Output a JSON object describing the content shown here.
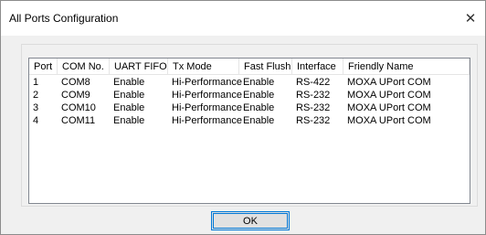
{
  "dialog": {
    "title": "All Ports Configuration",
    "close_glyph": "✕",
    "close_icon": "close-icon"
  },
  "table": {
    "columns": [
      "Port",
      "COM No.",
      "UART FIFO",
      "Tx Mode",
      "Fast Flush",
      "Interface",
      "Friendly Name"
    ],
    "rows": [
      [
        "1",
        "COM8",
        "Enable",
        "Hi-Performance",
        "Enable",
        "RS-422",
        "MOXA UPort COM"
      ],
      [
        "2",
        "COM9",
        "Enable",
        "Hi-Performance",
        "Enable",
        "RS-232",
        "MOXA UPort COM"
      ],
      [
        "3",
        "COM10",
        "Enable",
        "Hi-Performance",
        "Enable",
        "RS-232",
        "MOXA UPort COM"
      ],
      [
        "4",
        "COM11",
        "Enable",
        "Hi-Performance",
        "Enable",
        "RS-232",
        "MOXA UPort COM"
      ]
    ]
  },
  "buttons": {
    "ok_label": "OK"
  }
}
